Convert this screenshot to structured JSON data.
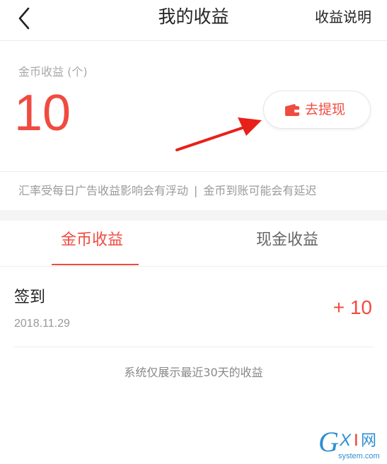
{
  "header": {
    "title": "我的收益",
    "explain_label": "收益说明"
  },
  "summary": {
    "coin_label": "金币收益 (个)",
    "coin_amount": "10",
    "withdraw_label": "去提现"
  },
  "notice": {
    "part1": "汇率受每日广告收益影响会有浮动",
    "divider": "|",
    "part2": "金币到账可能会有延迟"
  },
  "tabs": [
    {
      "label": "金币收益",
      "active": true
    },
    {
      "label": "现金收益",
      "active": false
    }
  ],
  "records": [
    {
      "title": "签到",
      "date": "2018.11.29",
      "amount": "+ 10"
    }
  ],
  "footer_note": "系统仅展示最近30天的收益",
  "watermark": {
    "brand": "GXI网",
    "domain": "system.com"
  },
  "colors": {
    "accent": "#f04b40",
    "annotation_arrow": "#e8201a"
  },
  "icons": {
    "back": "chevron-left-icon",
    "wallet": "wallet-icon"
  }
}
